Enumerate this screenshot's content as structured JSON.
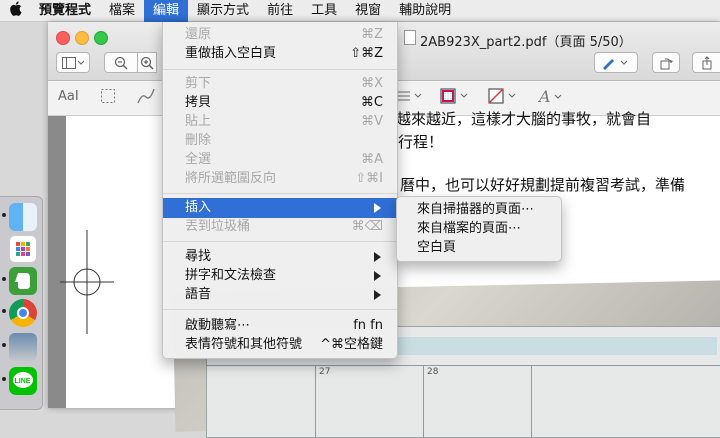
{
  "menubar": {
    "apple_icon": "apple-icon",
    "items": [
      {
        "label": "預覽程式"
      },
      {
        "label": "檔案"
      },
      {
        "label": "編輯"
      },
      {
        "label": "顯示方式"
      },
      {
        "label": "前往"
      },
      {
        "label": "工具"
      },
      {
        "label": "視窗"
      },
      {
        "label": "輔助說明"
      }
    ],
    "active_index": 2
  },
  "window": {
    "title": "2AB923X_part2.pdf（頁面 5/50）"
  },
  "edit_menu": {
    "items": [
      {
        "label": "還原",
        "shortcut": "⌘Z",
        "enabled": false
      },
      {
        "label": "重做插入空白頁",
        "shortcut": "⇧⌘Z",
        "enabled": true
      },
      {
        "label": "剪下",
        "shortcut": "⌘X",
        "enabled": false
      },
      {
        "label": "拷貝",
        "shortcut": "⌘C",
        "enabled": true
      },
      {
        "label": "貼上",
        "shortcut": "⌘V",
        "enabled": false
      },
      {
        "label": "刪除",
        "shortcut": "",
        "enabled": false
      },
      {
        "label": "全選",
        "shortcut": "⌘A",
        "enabled": false
      },
      {
        "label": "將所選範圍反向",
        "shortcut": "⇧⌘I",
        "enabled": false
      },
      {
        "label": "插入",
        "shortcut": "",
        "enabled": true,
        "highlighted": true
      },
      {
        "label": "丟到垃圾桶",
        "shortcut": "⌘⌫",
        "enabled": false
      },
      {
        "label": "尋找",
        "shortcut": "",
        "enabled": true
      },
      {
        "label": "拼字和文法檢查",
        "shortcut": "",
        "enabled": true
      },
      {
        "label": "語音",
        "shortcut": "",
        "enabled": true
      },
      {
        "label": "啟動聽寫⋯",
        "shortcut": "fn fn",
        "enabled": true
      },
      {
        "label": "表情符號和其他符號",
        "shortcut": "^⌘空格鍵",
        "enabled": true
      }
    ]
  },
  "insert_submenu": {
    "items": [
      {
        "label": "來自掃描器的頁面⋯"
      },
      {
        "label": "來自檔案的頁面⋯"
      },
      {
        "label": "空白頁"
      }
    ]
  },
  "document": {
    "line1": "越來越近，這樣才大腦的事牧，就會自",
    "line2": "行程！",
    "line3": "曆中，也可以好好規劃提前複習考試，準備"
  },
  "toolbar": {
    "text_tool": "AaI"
  },
  "notebook": {
    "numbers": [
      "27",
      "28"
    ]
  },
  "colors": {
    "menu_highlight": "#2f6fd6",
    "close": "#fc605c",
    "minimize": "#fdbc40",
    "zoom": "#34c84a"
  }
}
